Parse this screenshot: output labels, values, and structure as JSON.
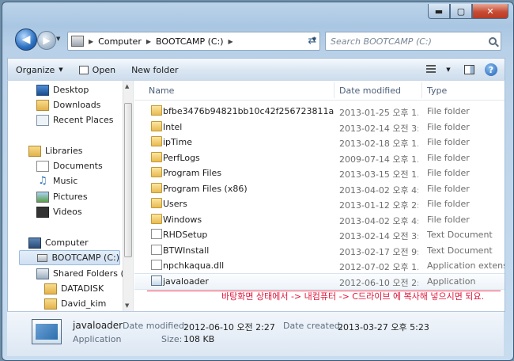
{
  "window": {
    "min_symbol": "▬",
    "max_symbol": "▢",
    "close_symbol": "✕"
  },
  "address": {
    "crumbs": [
      "Computer",
      "BOOTCAMP (C:)"
    ]
  },
  "search": {
    "placeholder": "Search BOOTCAMP (C:)"
  },
  "toolbar": {
    "organize": "Organize",
    "open": "Open",
    "new_folder": "New folder"
  },
  "nav": {
    "items": [
      {
        "label": "Desktop",
        "icon": "desktop-icon"
      },
      {
        "label": "Downloads",
        "icon": "downloads-folder-icon"
      },
      {
        "label": "Recent Places",
        "icon": "recent-places-icon"
      },
      {
        "label": "Libraries",
        "icon": "libraries-icon"
      },
      {
        "label": "Documents",
        "icon": "documents-icon"
      },
      {
        "label": "Music",
        "icon": "music-icon"
      },
      {
        "label": "Pictures",
        "icon": "pictures-icon"
      },
      {
        "label": "Videos",
        "icon": "videos-icon"
      },
      {
        "label": "Computer",
        "icon": "computer-icon"
      },
      {
        "label": "BOOTCAMP (C:)",
        "icon": "drive-icon"
      },
      {
        "label": "Shared Folders (\\",
        "icon": "shared-folder-icon"
      },
      {
        "label": "DATADISK",
        "icon": "folder-icon"
      },
      {
        "label": "David_kim",
        "icon": "folder-icon"
      }
    ]
  },
  "columns": {
    "name": "Name",
    "date": "Date modified",
    "type": "Type"
  },
  "files": [
    {
      "name": "bfbe3476b94821bb10c42f256723811a",
      "date": "2013-01-25 오후 1...",
      "type": "File folder",
      "icon": "locked-folder-icon"
    },
    {
      "name": "Intel",
      "date": "2013-02-14 오전 3:...",
      "type": "File folder",
      "icon": "folder-icon"
    },
    {
      "name": "ipTime",
      "date": "2013-02-18 오후 1...",
      "type": "File folder",
      "icon": "folder-icon"
    },
    {
      "name": "PerfLogs",
      "date": "2009-07-14 오후 1...",
      "type": "File folder",
      "icon": "folder-icon"
    },
    {
      "name": "Program Files",
      "date": "2013-03-15 오전 1...",
      "type": "File folder",
      "icon": "folder-icon"
    },
    {
      "name": "Program Files (x86)",
      "date": "2013-04-02 오후 4:...",
      "type": "File folder",
      "icon": "folder-icon"
    },
    {
      "name": "Users",
      "date": "2013-01-12 오후 2:...",
      "type": "File folder",
      "icon": "folder-icon"
    },
    {
      "name": "Windows",
      "date": "2013-04-02 오후 4:...",
      "type": "File folder",
      "icon": "folder-icon"
    },
    {
      "name": "RHDSetup",
      "date": "2013-02-14 오전 3:...",
      "type": "Text Document",
      "icon": "text-document-icon"
    },
    {
      "name": "BTWInstall",
      "date": "2013-02-17 오전 9:...",
      "type": "Text Document",
      "icon": "text-document-icon"
    },
    {
      "name": "npchkaqua.dll",
      "date": "2012-07-02 오후 1...",
      "type": "Application extens...",
      "icon": "dll-file-icon"
    },
    {
      "name": "javaloader",
      "date": "2012-06-10 오전 2:...",
      "type": "Application",
      "icon": "application-icon"
    }
  ],
  "annotation": "바탕화면 상태에서 -> 내컴퓨터 -> C드라이브 에 복사해 넣으시면 되요.",
  "details": {
    "name": "javaloader",
    "type": "Application",
    "date_modified_label": "Date modified:",
    "date_modified": "2012-06-10 오전 2:27",
    "date_created_label": "Date created:",
    "date_created": "2013-03-27 오후 5:23",
    "size_label": "Size:",
    "size": "108 KB"
  }
}
